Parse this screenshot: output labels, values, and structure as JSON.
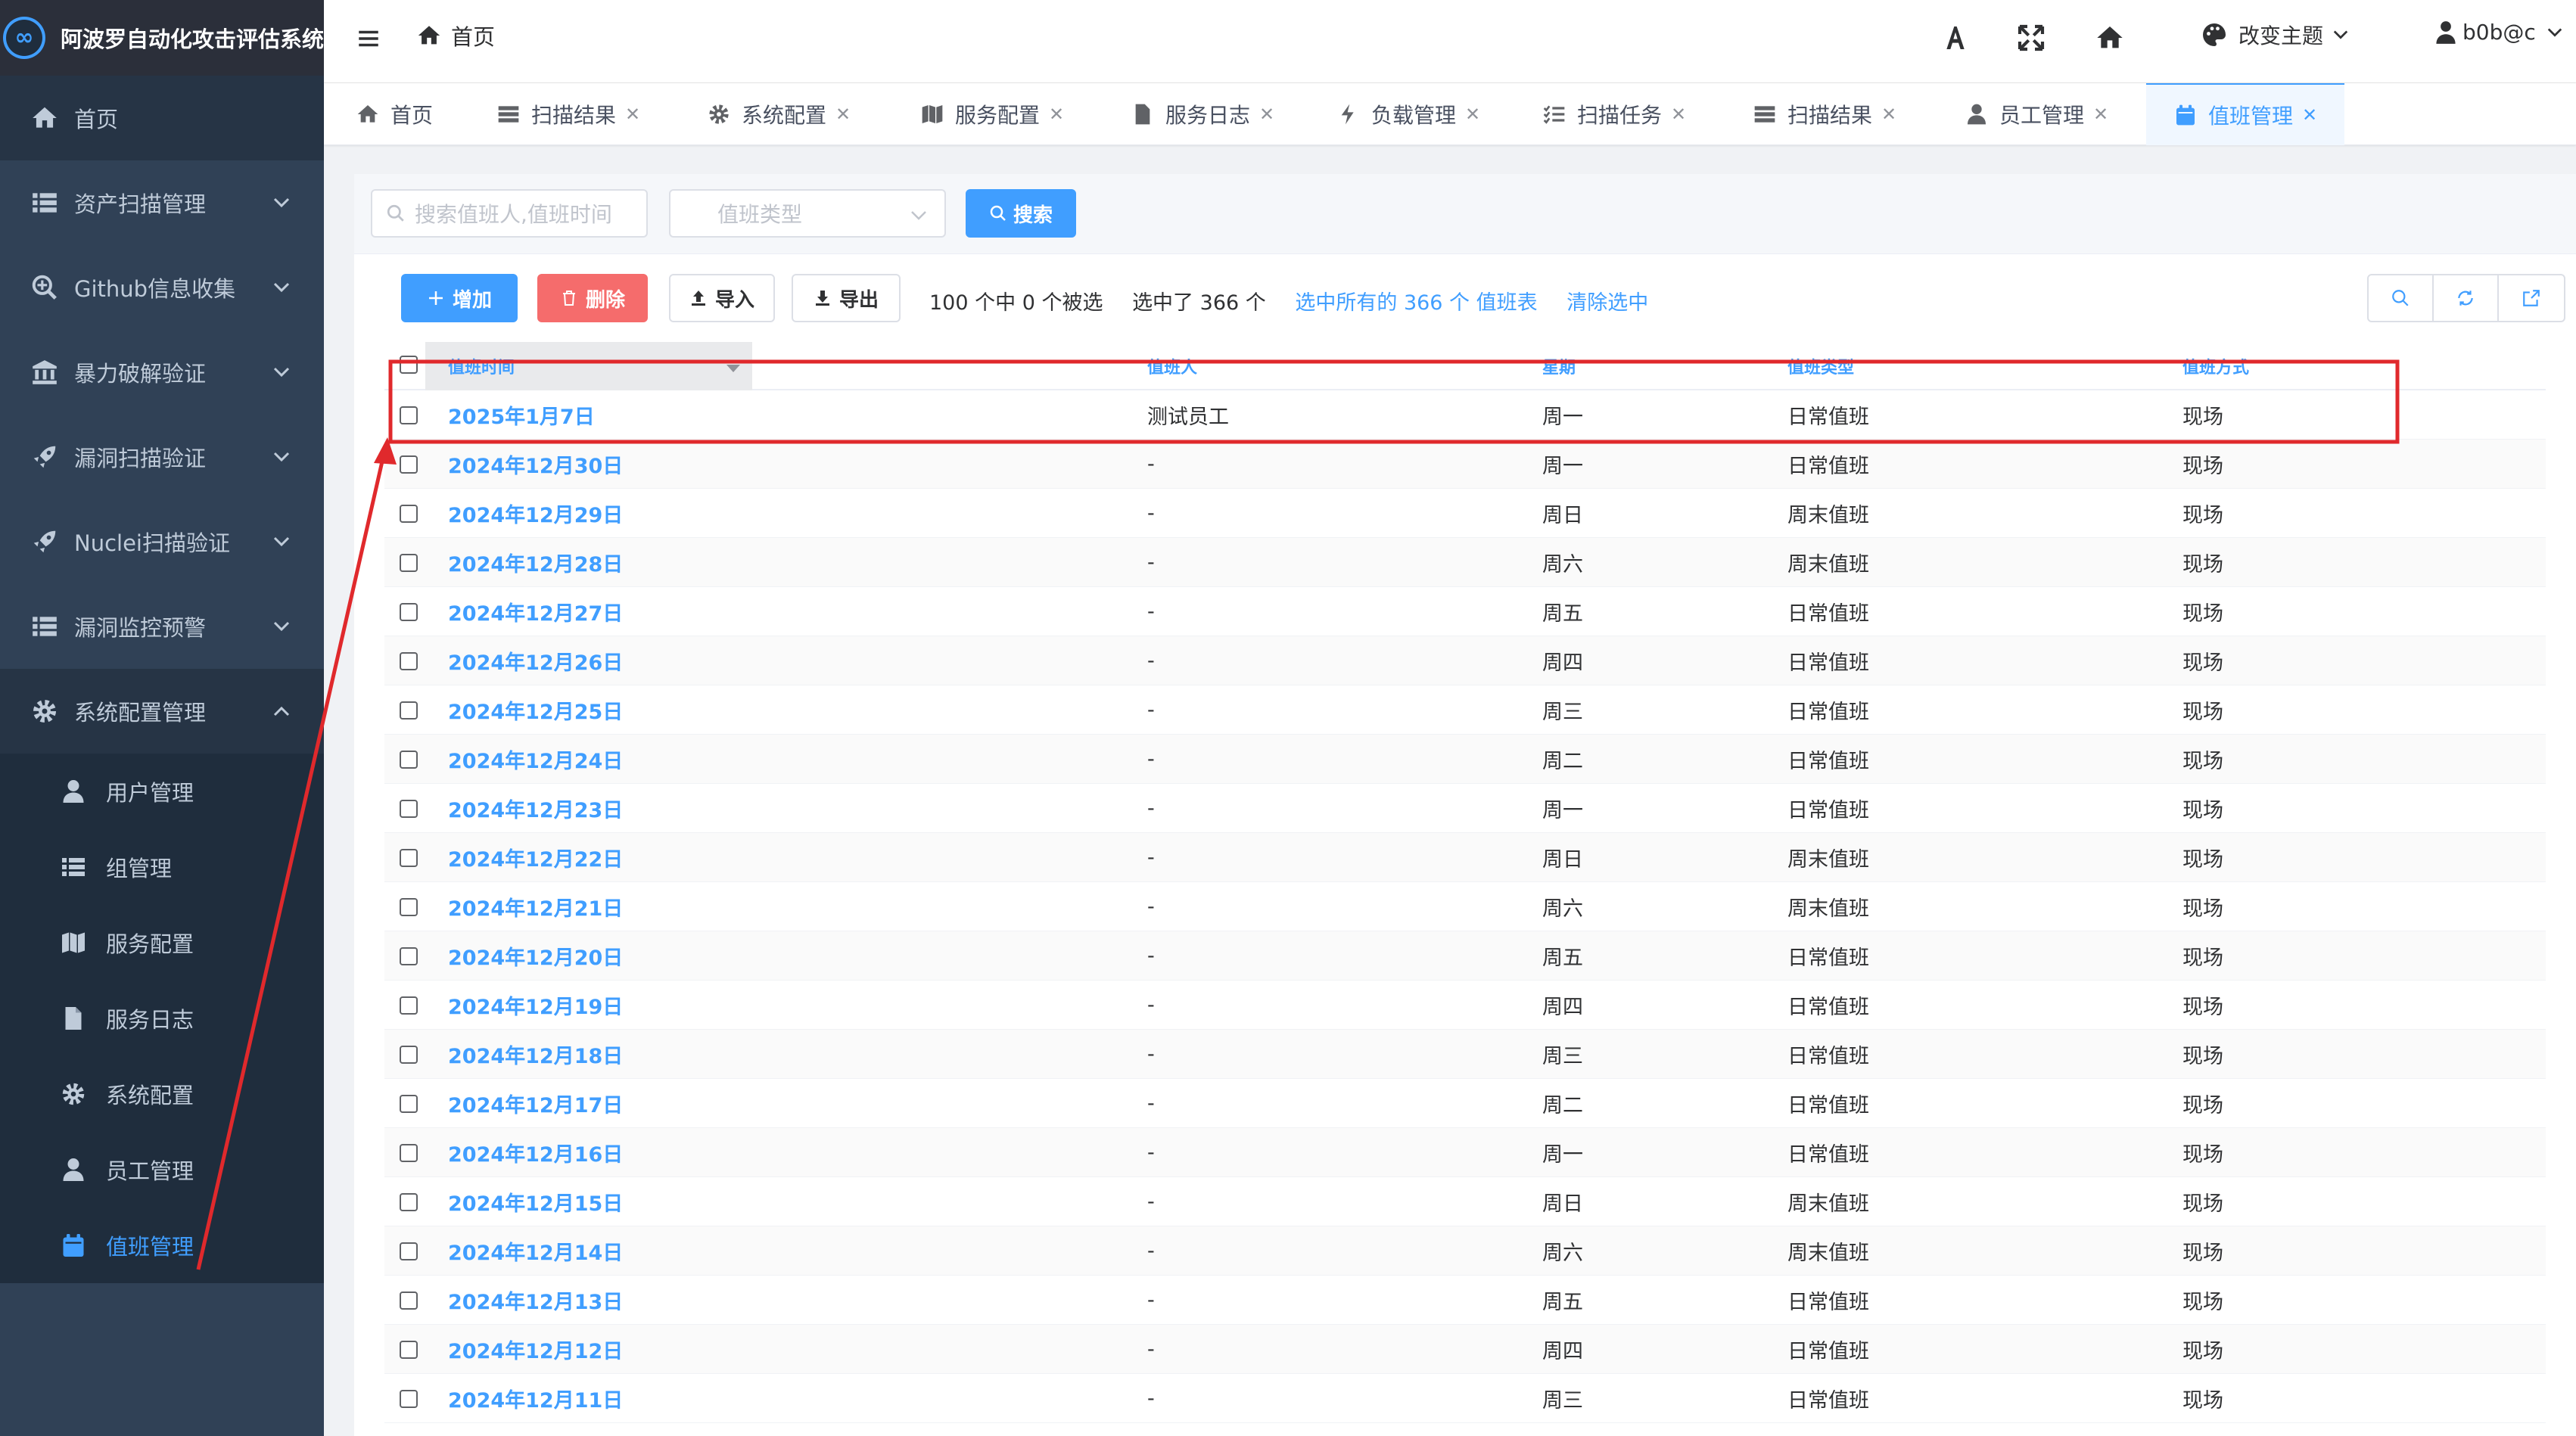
{
  "app": {
    "title": "阿波罗自动化攻击评估系统",
    "logo_text": "∞"
  },
  "sidebar": {
    "home": "首页",
    "menus": [
      {
        "label": "资产扫描管理",
        "icon": "list-icon"
      },
      {
        "label": "Github信息收集",
        "icon": "search-plus-icon"
      },
      {
        "label": "暴力破解验证",
        "icon": "bank-icon"
      },
      {
        "label": "漏洞扫描验证",
        "icon": "rocket-icon"
      },
      {
        "label": "Nuclei扫描验证",
        "icon": "rocket-icon"
      },
      {
        "label": "漏洞监控预警",
        "icon": "list-icon"
      },
      {
        "label": "系统配置管理",
        "icon": "gear-icon"
      }
    ],
    "submenu": [
      {
        "label": "用户管理",
        "icon": "user-icon"
      },
      {
        "label": "组管理",
        "icon": "list-icon"
      },
      {
        "label": "服务配置",
        "icon": "map-icon"
      },
      {
        "label": "服务日志",
        "icon": "file-icon"
      },
      {
        "label": "系统配置",
        "icon": "gear-icon"
      },
      {
        "label": "员工管理",
        "icon": "user-icon"
      },
      {
        "label": "值班管理",
        "icon": "calendar-icon"
      }
    ]
  },
  "header": {
    "breadcrumb": "首页",
    "theme_label": "改变主题",
    "username": "b0b@c"
  },
  "tabs": [
    {
      "label": "首页"
    },
    {
      "label": "扫描结果"
    },
    {
      "label": "系统配置"
    },
    {
      "label": "服务配置"
    },
    {
      "label": "服务日志"
    },
    {
      "label": "负载管理"
    },
    {
      "label": "扫描任务"
    },
    {
      "label": "扫描结果"
    },
    {
      "label": "员工管理"
    },
    {
      "label": "值班管理"
    }
  ],
  "search": {
    "placeholder": "搜索值班人,值班时间",
    "select_placeholder": "值班类型",
    "button": "搜索"
  },
  "toolbar": {
    "add": "增加",
    "delete": "删除",
    "import": "导入",
    "export": "导出",
    "selection_count": "100 个中 0 个被选",
    "selected_total": "选中了 366 个",
    "select_all": "选中所有的 366 个 值班表",
    "clear": "清除选中"
  },
  "table": {
    "columns": [
      "值班时间",
      "值班人",
      "星期",
      "值班类型",
      "值班方式"
    ],
    "rows": [
      [
        "2025年1月7日",
        "测试员工",
        "周一",
        "日常值班",
        "现场"
      ],
      [
        "2024年12月30日",
        "-",
        "周一",
        "日常值班",
        "现场"
      ],
      [
        "2024年12月29日",
        "-",
        "周日",
        "周末值班",
        "现场"
      ],
      [
        "2024年12月28日",
        "-",
        "周六",
        "周末值班",
        "现场"
      ],
      [
        "2024年12月27日",
        "-",
        "周五",
        "日常值班",
        "现场"
      ],
      [
        "2024年12月26日",
        "-",
        "周四",
        "日常值班",
        "现场"
      ],
      [
        "2024年12月25日",
        "-",
        "周三",
        "日常值班",
        "现场"
      ],
      [
        "2024年12月24日",
        "-",
        "周二",
        "日常值班",
        "现场"
      ],
      [
        "2024年12月23日",
        "-",
        "周一",
        "日常值班",
        "现场"
      ],
      [
        "2024年12月22日",
        "-",
        "周日",
        "周末值班",
        "现场"
      ],
      [
        "2024年12月21日",
        "-",
        "周六",
        "周末值班",
        "现场"
      ],
      [
        "2024年12月20日",
        "-",
        "周五",
        "日常值班",
        "现场"
      ],
      [
        "2024年12月19日",
        "-",
        "周四",
        "日常值班",
        "现场"
      ],
      [
        "2024年12月18日",
        "-",
        "周三",
        "日常值班",
        "现场"
      ],
      [
        "2024年12月17日",
        "-",
        "周二",
        "日常值班",
        "现场"
      ],
      [
        "2024年12月16日",
        "-",
        "周一",
        "日常值班",
        "现场"
      ],
      [
        "2024年12月15日",
        "-",
        "周日",
        "周末值班",
        "现场"
      ],
      [
        "2024年12月14日",
        "-",
        "周六",
        "周末值班",
        "现场"
      ],
      [
        "2024年12月13日",
        "-",
        "周五",
        "日常值班",
        "现场"
      ],
      [
        "2024年12月12日",
        "-",
        "周四",
        "日常值班",
        "现场"
      ],
      [
        "2024年12月11日",
        "-",
        "周三",
        "日常值班",
        "现场"
      ]
    ]
  },
  "colors": {
    "sidebar_bg": "#304156",
    "accent": "#409eff",
    "danger": "#f56c6c",
    "annotation": "#e0292c"
  }
}
